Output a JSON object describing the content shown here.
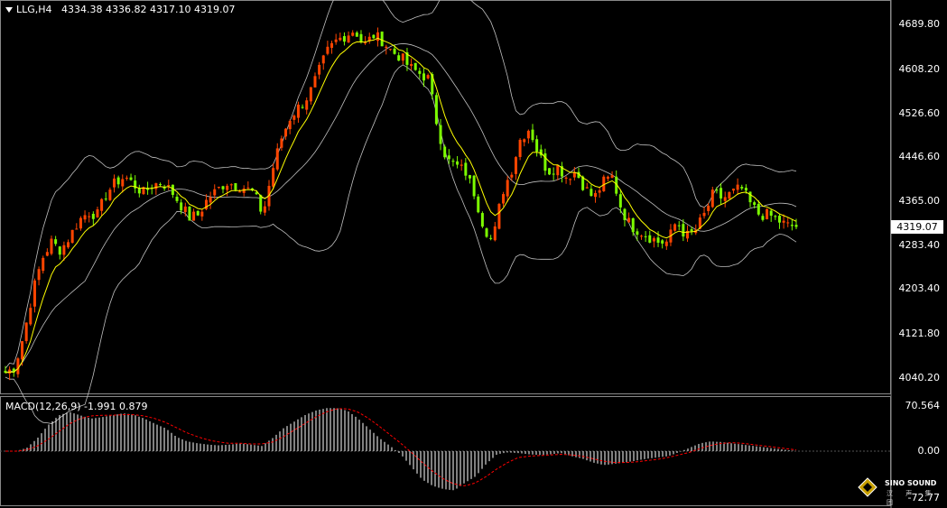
{
  "header": {
    "symbol": "LLG,H4",
    "ohlc": "4334.38 4336.82 4317.10 4319.07"
  },
  "price_axis": {
    "ticks": [
      "4689.80",
      "4608.20",
      "4526.60",
      "4446.60",
      "4365.00",
      "4283.40",
      "4203.40",
      "4121.80",
      "4040.20"
    ],
    "current_price": "4319.07"
  },
  "macd": {
    "label": "MACD(12,26,9) -1.991 0.879",
    "ticks": [
      "70.564",
      "0.00",
      "-72.77"
    ]
  },
  "watermark": {
    "brand_en": "SINO SOUND",
    "brand_cn": "汉 声 集 团"
  },
  "colors": {
    "background": "#000000",
    "bull_candle": "#ff4500",
    "bear_candle": "#7cfc00",
    "ma_line": "#ffff00",
    "bollinger": "#c0c0c0",
    "macd_hist": "#ffffff",
    "macd_signal": "#ff0000"
  },
  "chart_data": {
    "type": "candlestick",
    "ylim": [
      4010,
      4730
    ],
    "close_path": [
      4050,
      4060,
      4120,
      4200,
      4260,
      4290,
      4275,
      4300,
      4330,
      4345,
      4340,
      4380,
      4400,
      4410,
      4395,
      4380,
      4395,
      4400,
      4385,
      4360,
      4335,
      4340,
      4370,
      4385,
      4400,
      4395,
      4390,
      4380,
      4340,
      4420,
      4480,
      4520,
      4540,
      4560,
      4600,
      4640,
      4660,
      4670,
      4680,
      4650,
      4670,
      4660,
      4640,
      4630,
      4610,
      4600,
      4590,
      4500,
      4440,
      4430,
      4420,
      4380,
      4320,
      4290,
      4380,
      4420,
      4480,
      4500,
      4450,
      4420,
      4430,
      4410,
      4420,
      4390,
      4370,
      4400,
      4410,
      4350,
      4320,
      4310,
      4300,
      4290,
      4290,
      4330,
      4300,
      4310,
      4340,
      4380,
      4370,
      4380,
      4390,
      4360,
      4340,
      4340,
      4330,
      4320,
      4319
    ],
    "macd_ylim": [
      -72.77,
      70.564
    ],
    "macd_hist": [
      0,
      0,
      5,
      20,
      40,
      55,
      60,
      55,
      50,
      52,
      55,
      58,
      56,
      50,
      42,
      35,
      22,
      15,
      12,
      10,
      9,
      10,
      12,
      10,
      8,
      20,
      35,
      45,
      55,
      62,
      66,
      66,
      62,
      50,
      35,
      20,
      8,
      -5,
      -25,
      -45,
      -55,
      -60,
      -62,
      -50,
      -40,
      -20,
      -5,
      -2,
      -3,
      -5,
      -6,
      -5,
      -3,
      -8,
      -12,
      -18,
      -22,
      -20,
      -18,
      -15,
      -12,
      -10,
      -8,
      -2,
      5,
      12,
      15,
      14,
      12,
      10,
      8,
      6,
      4,
      2,
      0
    ],
    "macd_signal": [
      0,
      0,
      2,
      8,
      18,
      30,
      42,
      50,
      54,
      55,
      55,
      56,
      56,
      54,
      50,
      44,
      36,
      28,
      22,
      17,
      14,
      12,
      12,
      11,
      11,
      14,
      22,
      32,
      42,
      52,
      60,
      65,
      65,
      60,
      50,
      38,
      25,
      12,
      -2,
      -18,
      -32,
      -44,
      -52,
      -55,
      -50,
      -40,
      -28,
      -18,
      -10,
      -8,
      -7,
      -6,
      -5,
      -6,
      -8,
      -12,
      -16,
      -18,
      -18,
      -17,
      -15,
      -13,
      -10,
      -6,
      -2,
      4,
      9,
      12,
      13,
      12,
      10,
      8,
      6,
      4,
      2
    ]
  }
}
